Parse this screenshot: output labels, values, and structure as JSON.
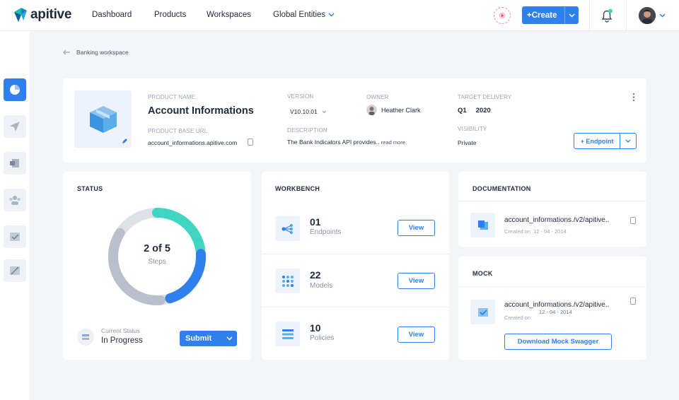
{
  "app": {
    "logo_text": "apitive"
  },
  "nav": {
    "items": [
      "Dashboard",
      "Products",
      "Workspaces"
    ],
    "dropdown": "Global Entities",
    "create_label": "+Create"
  },
  "breadcrumb": {
    "label": "Banking workspace"
  },
  "product": {
    "name_label": "PRODUCT NAME",
    "name": "Account Informations",
    "base_url_label": "PRODUCT BASE URL",
    "base_url": "account_informations.apitive.com",
    "version_label": "VERSION",
    "version": "V10.10.01",
    "description_label": "DESCRIPTION",
    "description": "The Bank Indicators API provides..",
    "read_more": "read more",
    "owner_label": "OWNER",
    "owner": "Heather Clark",
    "target_label": "TARGET DELIVERY",
    "target_quarter": "Q1",
    "target_year": "2020",
    "visibility_label": "VISIBILITY",
    "visibility": "Private",
    "endpoint_button": "+ Endpoint"
  },
  "status": {
    "title": "STATUS",
    "progress_text": "2 of 5",
    "steps_label": "Steps",
    "completed_fraction": 0.4,
    "current_label": "Current Status",
    "current_value": "In Progress",
    "submit_label": "Submit"
  },
  "workbench": {
    "title": "WORKBENCH",
    "rows": [
      {
        "count": "01",
        "label": "Endpoints",
        "button": "View"
      },
      {
        "count": "22",
        "label": "Models",
        "button": "View"
      },
      {
        "count": "10",
        "label": "Policies",
        "button": "View"
      }
    ]
  },
  "documentation": {
    "title": "DOCUMENTATION",
    "file": "account_informations./v2/apitive..",
    "created_label": "Created on",
    "created_date": "12 - 04 - 2014"
  },
  "mock": {
    "title": "MOCK",
    "file": "account_informations./v2/apitive..",
    "created_label": "Created on",
    "created_date": "12 - 04 - 2014",
    "download_label": "Download Mock Swagger"
  },
  "colors": {
    "accent": "#2f80ed",
    "teal": "#3ed6c0",
    "gray_ring": "#dde1e8",
    "dark_ring": "#b9c0cc"
  }
}
